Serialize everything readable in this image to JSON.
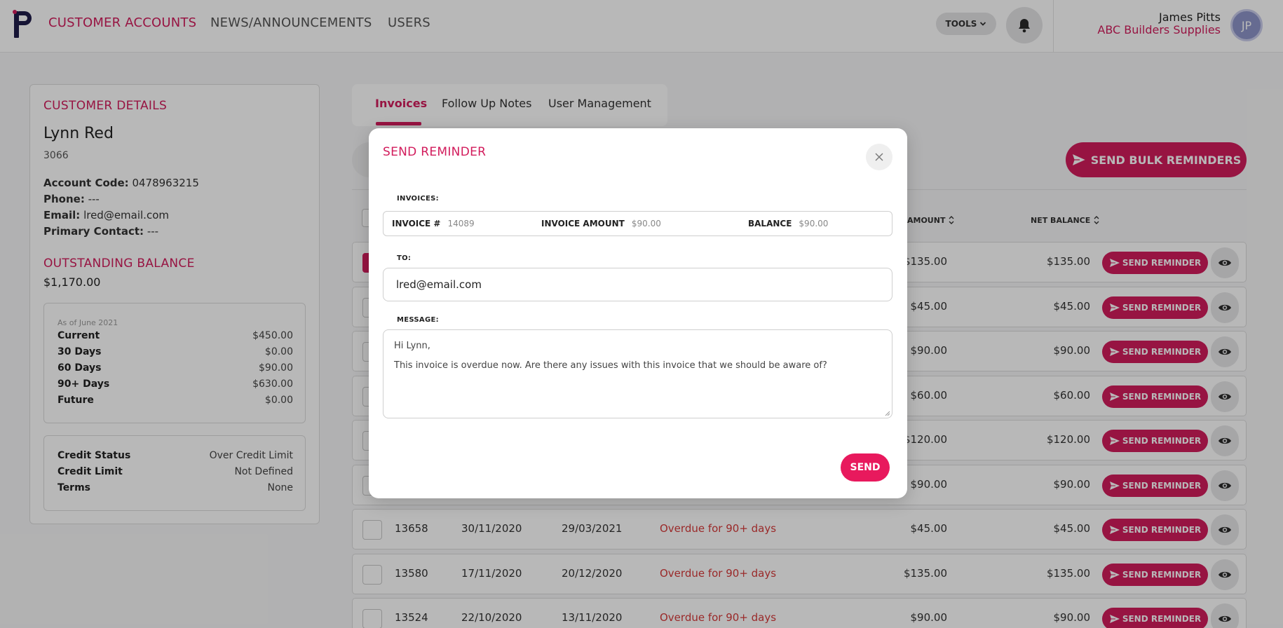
{
  "nav": {
    "links": [
      "CUSTOMER ACCOUNTS",
      "NEWS/ANNOUNCEMENTS",
      "USERS"
    ],
    "tools_label": "TOOLS",
    "user_name": "James Pitts",
    "company": "ABC Builders Supplies",
    "avatar_initials": "JP"
  },
  "customer": {
    "section_title": "CUSTOMER DETAILS",
    "name": "Lynn Red",
    "id": "3066",
    "account_code_label": "Account Code:",
    "account_code": "0478963215",
    "phone_label": "Phone:",
    "phone": "---",
    "email_label": "Email:",
    "email": "lred@email.com",
    "primary_contact_label": "Primary Contact:",
    "primary_contact": "---",
    "balance_title": "OUTSTANDING BALANCE",
    "balance": "$1,170.00",
    "as_of": "As of June 2021",
    "aging": [
      {
        "label": "Current",
        "value": "$450.00"
      },
      {
        "label": "30 Days",
        "value": "$0.00"
      },
      {
        "label": "60 Days",
        "value": "$90.00"
      },
      {
        "label": "90+ Days",
        "value": "$630.00"
      },
      {
        "label": "Future",
        "value": "$0.00"
      }
    ],
    "credit": [
      {
        "label": "Credit Status",
        "value": "Over Credit Limit"
      },
      {
        "label": "Credit Limit",
        "value": "Not Defined"
      },
      {
        "label": "Terms",
        "value": "None"
      }
    ]
  },
  "tabs": [
    "Invoices",
    "Follow Up Notes",
    "User Management"
  ],
  "bulk_label": "SEND BULK REMINDERS",
  "table": {
    "headers": {
      "amount": "AMOUNT",
      "net_balance": "NET BALANCE"
    },
    "send_label": "SEND REMINDER",
    "rows": [
      {
        "id": "",
        "date": "",
        "due": "",
        "status": "",
        "amount": "$135.00",
        "net": "$135.00",
        "checked": true
      },
      {
        "id": "",
        "date": "",
        "due": "",
        "status": "",
        "amount": "$45.00",
        "net": "$45.00",
        "checked": false
      },
      {
        "id": "",
        "date": "",
        "due": "",
        "status": "",
        "amount": "$90.00",
        "net": "$90.00",
        "checked": false
      },
      {
        "id": "",
        "date": "",
        "due": "",
        "status": "",
        "amount": "$60.00",
        "net": "$60.00",
        "checked": false
      },
      {
        "id": "",
        "date": "",
        "due": "",
        "status": "",
        "amount": "$120.00",
        "net": "$120.00",
        "checked": false
      },
      {
        "id": "",
        "date": "",
        "due": "",
        "status": "",
        "amount": "$90.00",
        "net": "$90.00",
        "checked": false
      },
      {
        "id": "13658",
        "date": "30/11/2020",
        "due": "29/03/2021",
        "status": "Overdue for 90+ days",
        "amount": "$45.00",
        "net": "$45.00",
        "checked": false
      },
      {
        "id": "13580",
        "date": "17/11/2020",
        "due": "20/12/2020",
        "status": "Overdue for 90+ days",
        "amount": "$135.00",
        "net": "$135.00",
        "checked": false
      },
      {
        "id": "13524",
        "date": "22/10/2020",
        "due": "13/11/2020",
        "status": "Overdue for 90+ days",
        "amount": "$90.00",
        "net": "$90.00",
        "checked": false
      }
    ]
  },
  "modal": {
    "title": "SEND REMINDER",
    "invoices_label": "INVOICES:",
    "invoice_num_label": "INVOICE #",
    "invoice_num": "14089",
    "invoice_amount_label": "INVOICE AMOUNT",
    "invoice_amount": "$90.00",
    "balance_label": "BALANCE",
    "balance": "$90.00",
    "to_label": "TO:",
    "to_value": "lred@email.com",
    "message_label": "MESSAGE:",
    "message_greeting": "Hi Lynn,",
    "message_body": "This invoice is overdue now. Are there any issues with this invoice that we should be aware of?",
    "send_label": "SEND"
  },
  "colors": {
    "accent": "#d21c5c",
    "overdue": "#d63a3a"
  }
}
